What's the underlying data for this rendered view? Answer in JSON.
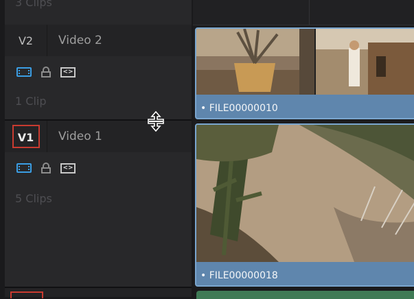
{
  "tracks": [
    {
      "id": "V2",
      "name": "Video 2",
      "selected": false,
      "clip_count": "1 Clip"
    },
    {
      "id": "V1",
      "name": "Video 1",
      "selected": true,
      "clip_count": "5 Clips"
    }
  ],
  "top_clip_count": "3 Clips",
  "track_icons": [
    "film-strip-icon",
    "lock-icon",
    "auto-select-icon"
  ],
  "auto_select_glyph": "<>",
  "clips": [
    {
      "track": "V2",
      "label": "• FILE00000010"
    },
    {
      "track": "V1",
      "label": "• FILE00000018"
    }
  ],
  "colors": {
    "selected_border": "#c93b30",
    "clip_blue": "#5f86ad",
    "icon_blue": "#3b9ee4",
    "audio_green": "#3f7a55"
  },
  "cursor": "move-cursor-icon"
}
